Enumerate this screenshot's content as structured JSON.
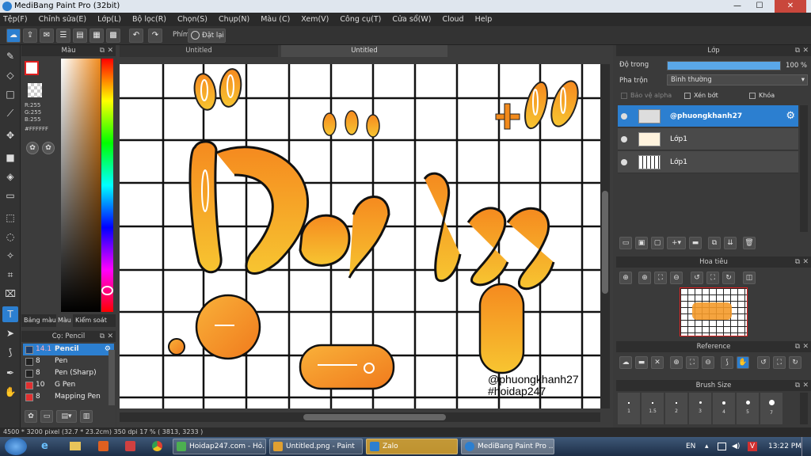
{
  "window": {
    "title": "MediBang Paint Pro (32bit)",
    "minimize": "—",
    "maximize": "☐",
    "close": "✕"
  },
  "menu": [
    "Tệp(F)",
    "Chỉnh sửa(E)",
    "Lớp(L)",
    "Bộ lọc(R)",
    "Chọn(S)",
    "Chụp(N)",
    "Màu (C)",
    "Xem(V)",
    "Công cụ(T)",
    "Cửa sổ(W)",
    "Cloud",
    "Help"
  ],
  "toolbar": {
    "phim_label": "Phím",
    "reset_label": "Đặt lại"
  },
  "color_panel": {
    "title": "Màu",
    "r": "R:255",
    "g": "G:255",
    "b": "B:255",
    "hex": "#FFFFFF",
    "tabs": [
      "Bảng màu",
      "Màu",
      "Kiểm soát cọ"
    ]
  },
  "brush_panel": {
    "title": "Cọ: Pencil",
    "items": [
      {
        "size": "14.1",
        "name": "Pencil",
        "color": "#1f3b66"
      },
      {
        "size": "8",
        "name": "Pen",
        "color": "#222222"
      },
      {
        "size": "8",
        "name": "Pen (Sharp)",
        "color": "#222222"
      },
      {
        "size": "10",
        "name": "G Pen",
        "color": "#e03030"
      },
      {
        "size": "8",
        "name": "Mapping Pen",
        "color": "#e03030"
      }
    ]
  },
  "doc_tabs": [
    "Untitled",
    "Untitled"
  ],
  "canvas": {
    "watermark_line1": "@phuongkhanh27",
    "watermark_line2": "#hoidap247"
  },
  "layer_panel": {
    "title": "Lớp",
    "opacity_label": "Độ trong",
    "opacity_value": "100 %",
    "opacity_fraction": 1.0,
    "blend_label": "Pha trộn",
    "blend_value": "Bình thường",
    "protect_alpha": "Bảo vệ alpha",
    "clipping": "Xén bớt",
    "lock": "Khóa",
    "layers": [
      {
        "name": "@phuongkhanh27",
        "selected": true
      },
      {
        "name": "Lớp1",
        "selected": false
      },
      {
        "name": "Lớp1",
        "selected": false
      }
    ]
  },
  "navigator": {
    "title": "Hoa tiêu"
  },
  "reference": {
    "title": "Reference"
  },
  "brush_size": {
    "title": "Brush Size",
    "sizes": [
      "1",
      "1.5",
      "2",
      "3",
      "4",
      "5",
      "7"
    ]
  },
  "status": {
    "text": "4500 * 3200 pixel   (32.7 * 23.2cm)   350 dpi   17 %   ( 3813, 3233 )"
  },
  "taskbar": {
    "tasks": [
      {
        "label": "Hoidap247.com - Hỏ...",
        "color": "#4caf50"
      },
      {
        "label": "Untitled.png - Paint",
        "color": "#e0a030"
      },
      {
        "label": "Zalo",
        "color": "#2c7fd0"
      },
      {
        "label": "MediBang Paint Pro ...",
        "color": "#2c7fd0"
      }
    ],
    "lang": "EN",
    "time": "13:22 PM"
  }
}
